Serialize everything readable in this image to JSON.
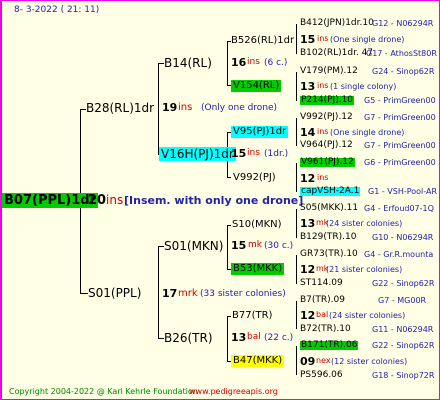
{
  "date": "8-  3-2022 ( 21: 11)",
  "footer": {
    "copyright": "Copyright 2004-2022 @ Karl Kehrle Foundation",
    "site": "www.pedigreeapis.org"
  },
  "root": {
    "name": "B07(PPL)1dr",
    "hl": "#00cc00",
    "num": "20",
    "unit": "ins",
    "desc": " [Insem. with only one drone]"
  },
  "colors": {
    "green": "#00cc00",
    "cyan": "#00ffff",
    "yellow": "#ffff00",
    "red": "#cc0000",
    "blue": "#2222aa",
    "border": "#ee00ee",
    "bg": "#ffffe6"
  },
  "gen1": [
    {
      "name": "B28(RL)1dr",
      "num": "19",
      "unit": "ins",
      "desc": "(Only one drone)"
    },
    {
      "name": "S01(PPL)",
      "num": "17",
      "unit": "mrk",
      "desc": "(33 sister colonies)"
    }
  ],
  "gen2": [
    {
      "name": "B14(RL)"
    },
    {
      "name": "V16H(PJ)1dr",
      "num": "15",
      "unit": "ins",
      "desc": "(1dr.)"
    },
    {
      "name": "S01(MKN)",
      "num": "15",
      "unit": "mk",
      "desc": "(30 c.)"
    },
    {
      "name": "B26(TR)",
      "num": "13",
      "unit": "bal",
      "desc": "(22 c.)"
    }
  ],
  "gen3": [
    {
      "name": "B526(RL)1dr",
      "num": "16",
      "unit": "ins",
      "desc": "(6 c.)"
    },
    {
      "name": "V154(RL)"
    },
    {
      "name": "V95(PJ)1dr"
    },
    {
      "name": "V992(PJ)"
    },
    {
      "name": "S10(MKN)"
    },
    {
      "name": "B53(MKK)"
    },
    {
      "name": "B77(TR)"
    },
    {
      "name": "B47(MKK)"
    }
  ],
  "gen4": [
    {
      "top": "B412(JPN)1dr.10",
      "topLink": "G12 - N06294R",
      "num": "15",
      "unit": "ins",
      "desc": "(One single drone)",
      "bot": "B102(RL)1dr. 47",
      "botLink": "G17 - AthosSt80R"
    },
    {
      "top": "V179(PM).12",
      "topLink": "G24 - Sinop62R",
      "num": "13",
      "unit": "ins",
      "desc": "(1 single colony)",
      "bot": "P214(PJ).10",
      "botLink": "G5 - PrimGreen00"
    },
    {
      "top": "V992(PJ).12",
      "topLink": "G7 - PrimGreen00",
      "num": "14",
      "unit": "ins",
      "desc": "(One single drone)",
      "bot": "V964(PJ).12",
      "botLink": "G7 - PrimGreen00"
    },
    {
      "top": "V961(PJ).12",
      "topLink": "G6 - PrimGreen00",
      "num": "12",
      "unit": "ins",
      "desc": "",
      "bot": "capVSH-2A.1",
      "botLink": "G1 - VSH-Pool-AR"
    },
    {
      "top": "S05(MKK).11",
      "topLink": "G4 - Erfoud07-1Q",
      "num": "13",
      "unit": "mk",
      "desc": "(24 sister colonies)",
      "bot": "B129(TR).10",
      "botLink": "G10 - N06294R"
    },
    {
      "top": "GR73(TR).10",
      "topLink": "G4 - Gr.R.mounta",
      "num": "12",
      "unit": "mk",
      "desc": "(21 sister colonies)",
      "bot": "ST114.09",
      "botLink": "G22 - Sinop62R"
    },
    {
      "top": "B7(TR).09",
      "topLink": "G7 - MG00R",
      "num": "12",
      "unit": "bal",
      "desc": "(24 sister colonies)",
      "bot": "B72(TR).10",
      "botLink": "G11 - N06294R"
    },
    {
      "top": "B171(TR).06",
      "topLink": "G22 - Sinop62R",
      "num": "09",
      "unit": "nex",
      "desc": "(12 sister colonies)",
      "bot": "PS596.06",
      "botLink": "G18 - Sinop72R"
    }
  ]
}
